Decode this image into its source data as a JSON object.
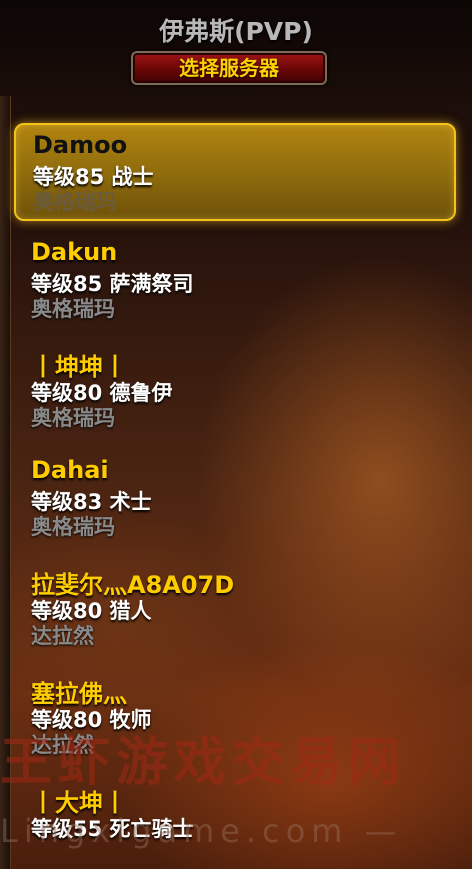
{
  "header": {
    "realm_title": "伊弗斯(PVP)",
    "server_button_label": "选择服务器"
  },
  "characters": [
    {
      "name": "Damoo",
      "level_class": "等级85 战士",
      "realm": "奥格瑞玛",
      "selected": true
    },
    {
      "name": "Dakun",
      "level_class": "等级85 萨满祭司",
      "realm": "奥格瑞玛",
      "selected": false
    },
    {
      "name": "丨坤坤丨",
      "level_class": "等级80 德鲁伊",
      "realm": "奥格瑞玛",
      "selected": false
    },
    {
      "name": "Dahai",
      "level_class": "等级83 术士",
      "realm": "奥格瑞玛",
      "selected": false
    },
    {
      "name": "拉斐尔灬A8A07D",
      "level_class": "等级80 猎人",
      "realm": "达拉然",
      "selected": false
    },
    {
      "name": "塞拉佛灬",
      "level_class": "等级80 牧师",
      "realm": "达拉然",
      "selected": false
    },
    {
      "name": "丨大坤丨",
      "level_class": "等级55 死亡骑士",
      "realm": "",
      "selected": false
    }
  ],
  "watermark": {
    "text": "王虾游戏交易网",
    "url": "Lingxigame.com —"
  },
  "colors": {
    "name_gold": "#ffcc00",
    "selection_gold": "#f5c21a",
    "button_red": "#a01414"
  }
}
